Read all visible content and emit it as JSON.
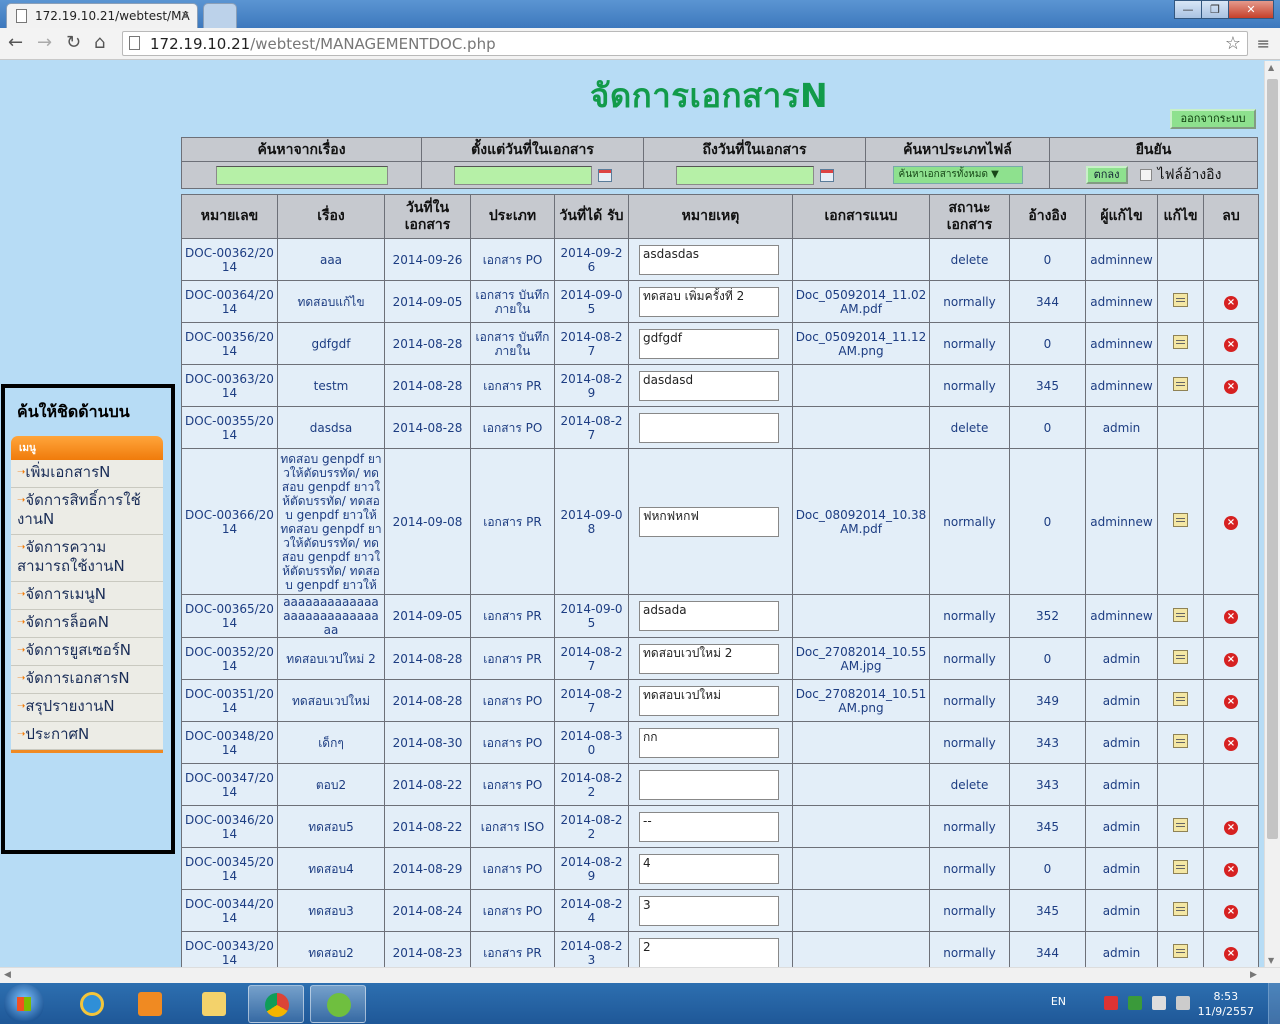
{
  "browser": {
    "tab_title": "172.19.10.21/webtest/MA",
    "tab_close": "×",
    "url_host": "172.19.10.21",
    "url_path": "/webtest/MANAGEMENTDOC.php",
    "back": "←",
    "forward": "→",
    "reload": "↻",
    "home": "⌂",
    "star": "☆",
    "menu": "≡",
    "minimize": "—",
    "maximize": "❐",
    "close": "✕"
  },
  "page": {
    "title": "จัดการเอกสารN",
    "logout_label": "ออกจากระบบ"
  },
  "search": {
    "headers": [
      "ค้นหาจากเรื่อง",
      "ตั้งแต่วันที่ในเอกสาร",
      "ถึงวันที่ในเอกสาร",
      "ค้นหาประเภทไฟล์",
      "ยืนยัน"
    ],
    "type_select": "ค้นหาเอกสารทั้งหมด ▼",
    "ok_label": "ตกลง",
    "ref_label": "ไฟล์อ้างอิง"
  },
  "table": {
    "headers": [
      "หมายเลข",
      "เรื่อง",
      "วันที่ใน เอกสาร",
      "ประเภท",
      "วันที่ได้ รับ",
      "หมายเหตุ",
      "เอกสารแนบ",
      "สถานะ เอกสาร",
      "อ้างอิง",
      "ผู้แก้ไข",
      "แก้ไข",
      "ลบ"
    ],
    "rows": [
      {
        "id": "DOC-00362/2014",
        "subject": "aaa",
        "doc_date": "2014-09-26",
        "type": "เอกสาร PO",
        "recv_date": "2014-09-26",
        "note": "asdasdas",
        "attach": "",
        "status": "delete",
        "ref": "0",
        "editor": "adminnew",
        "icons": false
      },
      {
        "id": "DOC-00364/2014",
        "subject": "ทดสอบแก้ไข",
        "doc_date": "2014-09-05",
        "type": "เอกสาร บันทึกภายใน",
        "recv_date": "2014-09-05",
        "note": "ทดสอบ เพิ่มครั้งที่ 2",
        "attach": "Doc_05092014_11.02 AM.pdf",
        "status": "normally",
        "ref": "344",
        "editor": "adminnew",
        "icons": true
      },
      {
        "id": "DOC-00356/2014",
        "subject": "gdfgdf",
        "doc_date": "2014-08-28",
        "type": "เอกสาร บันทึกภายใน",
        "recv_date": "2014-08-27",
        "note": "gdfgdf",
        "attach": "Doc_05092014_11.12 AM.png",
        "status": "normally",
        "ref": "0",
        "editor": "adminnew",
        "icons": true
      },
      {
        "id": "DOC-00363/2014",
        "subject": "testm",
        "doc_date": "2014-08-28",
        "type": "เอกสาร PR",
        "recv_date": "2014-08-29",
        "note": "dasdasd",
        "attach": "",
        "status": "normally",
        "ref": "345",
        "editor": "adminnew",
        "icons": true
      },
      {
        "id": "DOC-00355/2014",
        "subject": "dasdsa",
        "doc_date": "2014-08-28",
        "type": "เอกสาร PO",
        "recv_date": "2014-08-27",
        "note": "",
        "attach": "",
        "status": "delete",
        "ref": "0",
        "editor": "admin",
        "icons": false
      },
      {
        "id": "DOC-00366/2014",
        "subject": "ทดสอบ genpdf ยาวให้ตัดบรรทัด/ ทดสอบ genpdf ยาวให้ตัดบรรทัด/ ทดสอบ genpdf ยาวให้ ทดสอบ genpdf ยาวให้ตัดบรรทัด/ ทดสอบ genpdf ยาวให้ตัดบรรทัด/ ทดสอบ genpdf ยาวให้",
        "doc_date": "2014-09-08",
        "type": "เอกสาร PR",
        "recv_date": "2014-09-08",
        "note": "ฟหกฟหกฟ",
        "attach": "Doc_08092014_10.38 AM.pdf",
        "status": "normally",
        "ref": "0",
        "editor": "adminnew",
        "icons": true
      },
      {
        "id": "DOC-00365/2014",
        "subject": "aaaaaaaaaaaaaaaaaaaaaaaaaaaa",
        "doc_date": "2014-09-05",
        "type": "เอกสาร PR",
        "recv_date": "2014-09-05",
        "note": "adsada",
        "attach": "",
        "status": "normally",
        "ref": "352",
        "editor": "adminnew",
        "icons": true
      },
      {
        "id": "DOC-00352/2014",
        "subject": "ทดสอบเวปใหม่ 2",
        "doc_date": "2014-08-28",
        "type": "เอกสาร PR",
        "recv_date": "2014-08-27",
        "note": "ทดสอบเวปใหม่  2",
        "attach": "Doc_27082014_10.55 AM.jpg",
        "status": "normally",
        "ref": "0",
        "editor": "admin",
        "icons": true
      },
      {
        "id": "DOC-00351/2014",
        "subject": "ทดสอบเวปใหม่",
        "doc_date": "2014-08-28",
        "type": "เอกสาร PO",
        "recv_date": "2014-08-27",
        "note": "ทดสอบเวปใหม่",
        "attach": "Doc_27082014_10.51 AM.png",
        "status": "normally",
        "ref": "349",
        "editor": "admin",
        "icons": true
      },
      {
        "id": "DOC-00348/2014",
        "subject": "เด็กๆ",
        "doc_date": "2014-08-30",
        "type": "เอกสาร PO",
        "recv_date": "2014-08-30",
        "note": "กก",
        "attach": "",
        "status": "normally",
        "ref": "343",
        "editor": "admin",
        "icons": true
      },
      {
        "id": "DOC-00347/2014",
        "subject": "ตอบ2",
        "doc_date": "2014-08-22",
        "type": "เอกสาร PO",
        "recv_date": "2014-08-22",
        "note": "",
        "attach": "",
        "status": "delete",
        "ref": "343",
        "editor": "admin",
        "icons": false
      },
      {
        "id": "DOC-00346/2014",
        "subject": "ทดสอบ5",
        "doc_date": "2014-08-22",
        "type": "เอกสาร ISO",
        "recv_date": "2014-08-22",
        "note": "--",
        "attach": "",
        "status": "normally",
        "ref": "345",
        "editor": "admin",
        "icons": true
      },
      {
        "id": "DOC-00345/2014",
        "subject": "ทดสอบ4",
        "doc_date": "2014-08-29",
        "type": "เอกสาร PO",
        "recv_date": "2014-08-29",
        "note": "4",
        "attach": "",
        "status": "normally",
        "ref": "0",
        "editor": "admin",
        "icons": true
      },
      {
        "id": "DOC-00344/2014",
        "subject": "ทดสอบ3",
        "doc_date": "2014-08-24",
        "type": "เอกสาร PO",
        "recv_date": "2014-08-24",
        "note": "3",
        "attach": "",
        "status": "normally",
        "ref": "345",
        "editor": "admin",
        "icons": true
      },
      {
        "id": "DOC-00343/2014",
        "subject": "ทดสอบ2",
        "doc_date": "2014-08-23",
        "type": "เอกสาร PR",
        "recv_date": "2014-08-23",
        "note": "2",
        "attach": "",
        "status": "normally",
        "ref": "344",
        "editor": "admin",
        "icons": true
      }
    ]
  },
  "sidebar": {
    "title": "ค้นให้ชิดด้านบน",
    "menu_label": "เมนู",
    "items": [
      "เพิ่มเอกสารN",
      "จัดการสิทธิ์การใช้งานN",
      "จัดการความสามารถใช้งานN",
      "จัดการเมนูN",
      "จัดการล็อคN",
      "จัดการยูสเซอร์N",
      "จัดการเอกสารN",
      "สรุปรายงานN",
      "ประกาศN"
    ]
  },
  "taskbar": {
    "lang": "EN",
    "time": "8:53",
    "date": "11/9/2557"
  },
  "colors": {
    "title_green": "#129b4a",
    "page_bg": "#b7dcf5",
    "menu_orange": "#f07b0b",
    "delete_red": "#d62121"
  }
}
